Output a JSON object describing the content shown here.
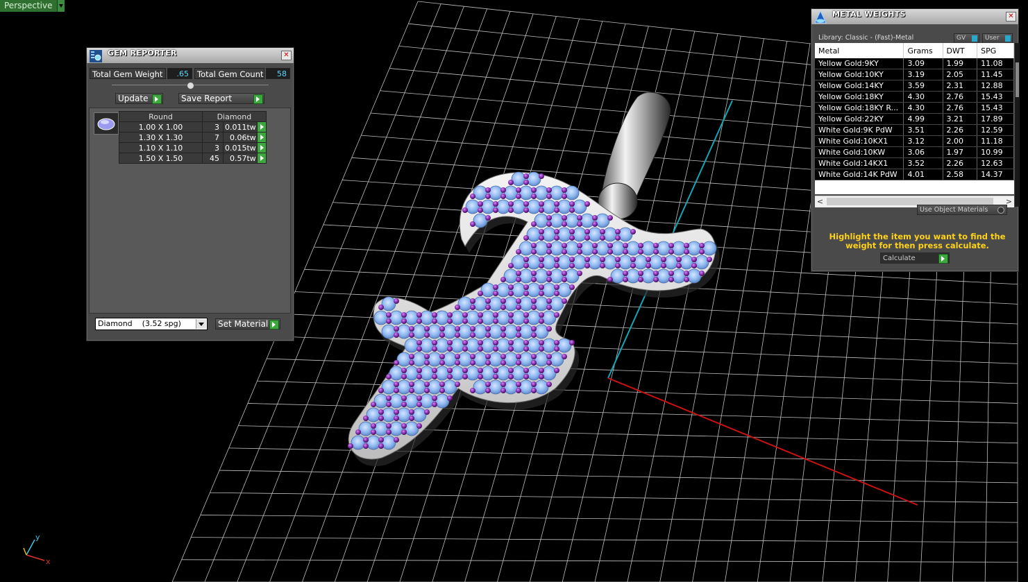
{
  "viewport": {
    "label": "Perspective",
    "colors": {
      "grid": "#bfbfbf",
      "x_axis": "#cc1111",
      "y_axis": "#14a6b8",
      "gem_blue": "#8fb8f0",
      "prong_purple": "#8d2fb4",
      "metal": "#e6e6e6"
    },
    "axis_gizmo": {
      "x": "x",
      "y": "y"
    }
  },
  "gem_reporter": {
    "title": "GEM REPORTER",
    "icon": "gem-reporter-icon",
    "total_weight_label": "Total Gem Weight",
    "total_weight_value": ".65",
    "total_count_label": "Total Gem Count",
    "total_count_value": "58",
    "update_label": "Update",
    "save_report_label": "Save Report",
    "headers": [
      "Round",
      "Diamond"
    ],
    "rows": [
      {
        "size": "1.00 X 1.00",
        "count": "3",
        "weight": "0.011tw"
      },
      {
        "size": "1.30 X 1.30",
        "count": "7",
        "weight": "0.06tw"
      },
      {
        "size": "1.10 X 1.10",
        "count": "3",
        "weight": "0.015tw"
      },
      {
        "size": "1.50 X 1.50",
        "count": "45",
        "weight": "0.57tw"
      }
    ],
    "material_select": "Diamond    (3.52 spg)",
    "set_material_label": "Set Material"
  },
  "metal_weights": {
    "title": "METAL WEIGHTS",
    "icon": "metal-weights-icon",
    "library": "Library: Classic - (Fast)-Metal",
    "gv_label": "GV",
    "user_label": "User",
    "headers": [
      "Metal",
      "Grams",
      "DWT",
      "SPG"
    ],
    "rows": [
      [
        "Yellow Gold:9KY",
        "3.09",
        "1.99",
        "11.08"
      ],
      [
        "Yellow Gold:10KY",
        "3.19",
        "2.05",
        "11.45"
      ],
      [
        "Yellow Gold:14KY",
        "3.59",
        "2.31",
        "12.88"
      ],
      [
        "Yellow Gold:18KY",
        "4.30",
        "2.76",
        "15.43"
      ],
      [
        "Yellow Gold:18KY R...",
        "4.30",
        "2.76",
        "15.43"
      ],
      [
        "Yellow Gold:22KY",
        "4.99",
        "3.21",
        "17.89"
      ],
      [
        "White Gold:9K PdW",
        "3.51",
        "2.26",
        "12.59"
      ],
      [
        "White Gold:10KX1",
        "3.12",
        "2.00",
        "11.18"
      ],
      [
        "White Gold:10KW",
        "3.06",
        "1.97",
        "10.99"
      ],
      [
        "White Gold:14KX1",
        "3.52",
        "2.26",
        "12.63"
      ],
      [
        "White Gold:14K PdW",
        "4.01",
        "2.58",
        "14.37"
      ]
    ],
    "use_object_materials": "Use Object Materials",
    "hint": "Highlight the item you want to find the weight for then press calculate.",
    "calculate_label": "Calculate"
  }
}
